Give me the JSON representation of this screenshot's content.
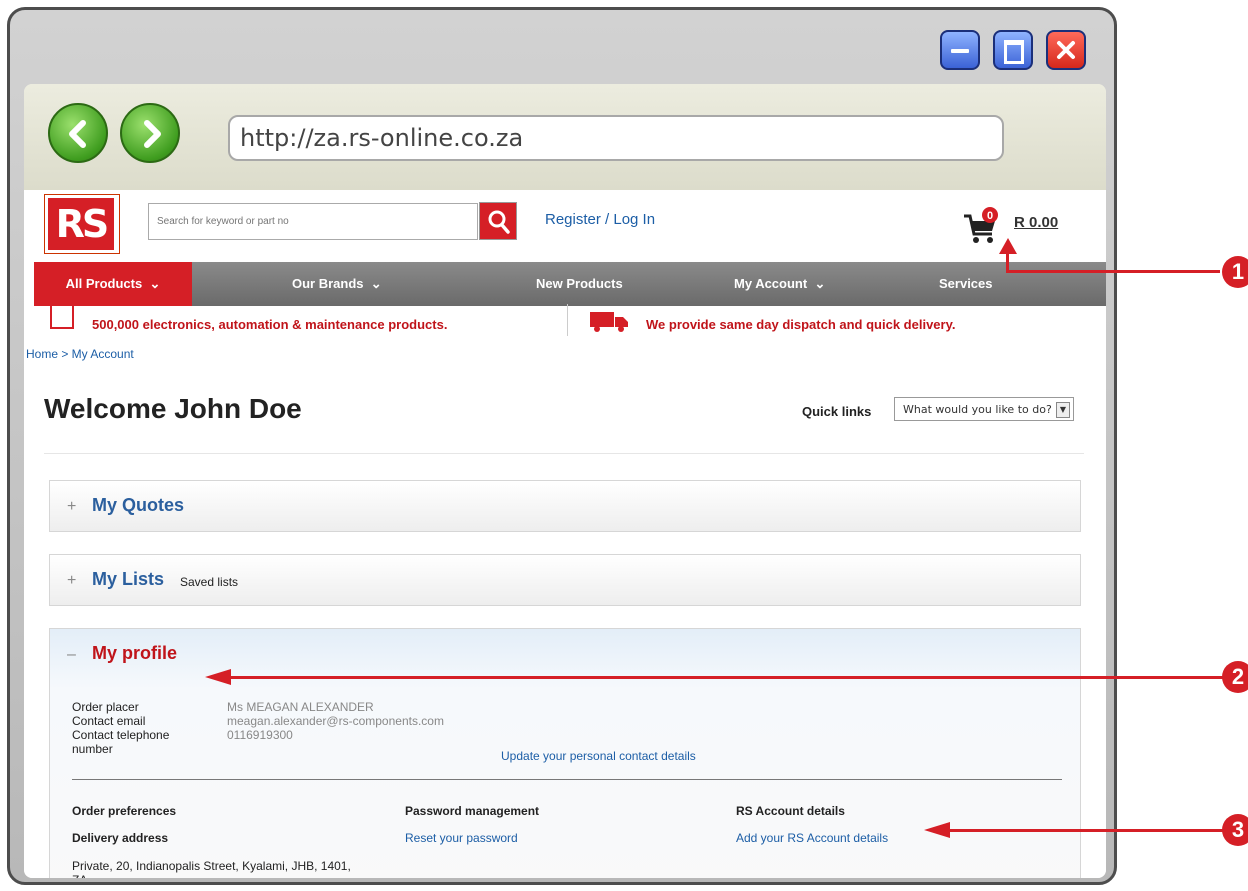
{
  "browser": {
    "url": "http://za.rs-online.co.za"
  },
  "header": {
    "logo_text": "RS",
    "search_placeholder": "Search for keyword or part no",
    "register_login": "Register / Log In",
    "cart_count": "0",
    "cart_total": "R 0.00"
  },
  "menu": {
    "items": [
      {
        "label": "All Products"
      },
      {
        "label": "Our Brands"
      },
      {
        "label": "New Products"
      },
      {
        "label": "My Account"
      },
      {
        "label": "Services"
      }
    ]
  },
  "promos": {
    "left": "500,000 electronics, automation & maintenance products.",
    "right": "We provide same day dispatch and quick delivery."
  },
  "breadcrumb": "Home  >  My Account",
  "welcome": "Welcome John Doe",
  "quick_links": {
    "label": "Quick links",
    "selected": "What would you like to do?"
  },
  "panels": {
    "quotes": {
      "title": "My Quotes",
      "toggle": "+"
    },
    "lists": {
      "title": "My Lists",
      "subtitle": "Saved lists",
      "toggle": "+"
    },
    "profile": {
      "title": "My profile",
      "toggle": "–"
    }
  },
  "profile": {
    "order_placer_label": "Order placer",
    "order_placer_value": "Ms MEAGAN ALEXANDER",
    "email_label": "Contact email",
    "email_value": "meagan.alexander@rs-components.com",
    "phone_label": "Contact telephone",
    "phone_label_2": "number",
    "phone_value": "0116919300",
    "update_link": "Update your personal contact details",
    "order_prefs": "Order preferences",
    "delivery_label": "Delivery address",
    "delivery_value": "Private, 20, Indianopalis Street, Kyalami, JHB, 1401,",
    "delivery_value_2": "ZA",
    "password_heading": "Password management",
    "reset_password": "Reset your password",
    "account_heading": "RS Account details",
    "add_account": "Add your RS Account details"
  },
  "annotations": [
    "1",
    "2",
    "3"
  ],
  "colors": {
    "brand_red": "#d51f26",
    "link_blue": "#1c5ea6",
    "menu_gray": "#7a7a7a"
  }
}
